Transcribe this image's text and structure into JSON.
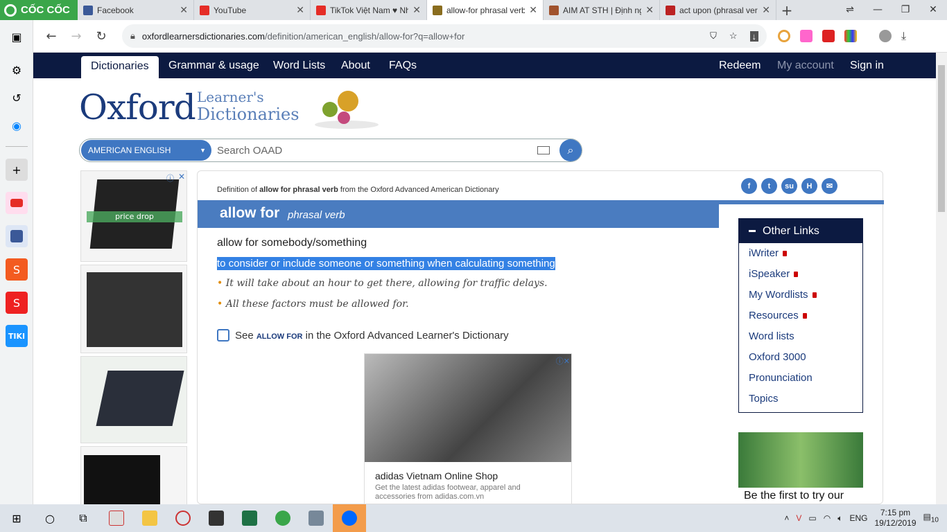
{
  "browser": {
    "brand": "CỐC CỐC",
    "tabs": [
      {
        "title": "Facebook",
        "color": "#3b5998",
        "active": false
      },
      {
        "title": "YouTube",
        "color": "#e52d27",
        "active": false
      },
      {
        "title": "TikTok Việt Nam ♥ Nh",
        "color": "#e52d27",
        "active": false
      },
      {
        "title": "allow-for phrasal verb",
        "color": "#8a6d1f",
        "active": true
      },
      {
        "title": "AIM AT STH | Định ng",
        "color": "#a0522d",
        "active": false
      },
      {
        "title": "act upon (phrasal ver",
        "color": "#b22",
        "active": false
      }
    ],
    "url_domain": "oxfordlearnersdictionaries.com",
    "url_path": "/definition/american_english/allow-for?q=allow+for"
  },
  "nav": {
    "items": [
      "Dictionaries",
      "Grammar & usage",
      "Word Lists",
      "About",
      "FAQs"
    ],
    "right": [
      "Redeem",
      "My account",
      "Sign in"
    ]
  },
  "logo": {
    "oxford": "Oxford",
    "learners": "Learner's",
    "dictionaries": "Dictionaries"
  },
  "search": {
    "lang": "AMERICAN ENGLISH",
    "placeholder": "Search OAAD"
  },
  "entry": {
    "defof_prefix": "Definition of ",
    "defof_word": "allow for phrasal verb",
    "defof_suffix": " from the Oxford Advanced American Dictionary",
    "headword": "allow for",
    "pos": "phrasal verb",
    "sense": "allow for somebody/something",
    "definition": "to consider or include someone or something when calculating something",
    "examples": [
      "It will take about an hour to get there, allowing for traffic delays.",
      "All these factors must be allowed for."
    ],
    "see_prefix": "See ",
    "see_word": "ALLOW FOR",
    "see_suffix": " in the Oxford Advanced Learner's Dictionary"
  },
  "ad": {
    "title": "adidas Vietnam Online Shop",
    "desc": "Get the latest adidas footwear, apparel and accessories from adidas.com.vn",
    "price_drop": "price drop"
  },
  "other_links": {
    "heading": "Other Links",
    "items": [
      {
        "label": "iWriter",
        "locked": true
      },
      {
        "label": "iSpeaker",
        "locked": true
      },
      {
        "label": "My Wordlists",
        "locked": true
      },
      {
        "label": "Resources",
        "locked": true
      },
      {
        "label": "Word lists",
        "locked": false
      },
      {
        "label": "Oxford 3000",
        "locked": false
      },
      {
        "label": "Pronunciation",
        "locked": false
      },
      {
        "label": "Topics",
        "locked": false
      }
    ]
  },
  "promo_text": "Be the first to try our",
  "taskbar": {
    "lang": "ENG",
    "time": "7:15 pm",
    "date": "19/12/2019",
    "notif": "10"
  }
}
